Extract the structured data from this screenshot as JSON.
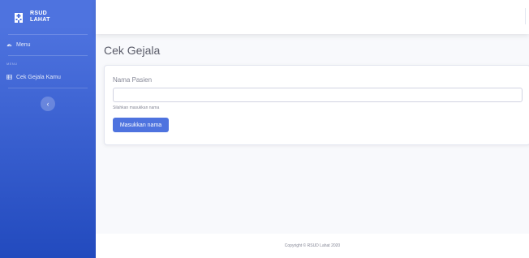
{
  "brand": {
    "line1": "RSUD",
    "line2": "LAHAT",
    "icon": "hospital-icon"
  },
  "sidebar": {
    "menu_item": {
      "label": "Menu",
      "icon": "dashboard-icon"
    },
    "heading": "MENU",
    "items": [
      {
        "label": "Cek Gejala Kamu",
        "icon": "table-icon"
      }
    ],
    "toggle_icon": "chevron-left-icon"
  },
  "page": {
    "title": "Cek Gejala"
  },
  "form": {
    "label": "Nama Pasien",
    "input_value": "",
    "help": "Silahkan masukkan nama",
    "button": "Masukkan nama"
  },
  "footer": {
    "copyright": "Copyright © RSUD Lahat 2020"
  },
  "colors": {
    "primary": "#4e73df",
    "primary_dark": "#224abe",
    "text_muted": "#858796"
  }
}
